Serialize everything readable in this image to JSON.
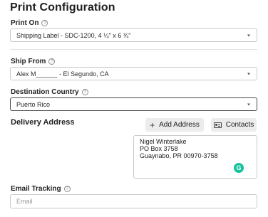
{
  "panel": {
    "title": "Print Configuration"
  },
  "print_on": {
    "label": "Print On",
    "value": "Shipping Label - SDC-1200, 4 ¼\" x 6 ¾\""
  },
  "ship_from": {
    "label": "Ship From",
    "value": "Alex M______ - El Segundo, CA"
  },
  "destination_country": {
    "label": "Destination Country",
    "value": "Puerto Rico"
  },
  "delivery_address": {
    "label": "Delivery Address",
    "add_button_label": "Add Address",
    "contacts_button_label": "Contacts",
    "lines": [
      "Nigel Winterlake",
      "PO Box 3758",
      "Guaynabo, PR 00970-3758"
    ],
    "grammarly_letter": "G"
  },
  "email_tracking": {
    "label": "Email Tracking",
    "placeholder": "Email"
  },
  "icons": {
    "help": "?",
    "plus": "+"
  },
  "colors": {
    "grammarly": "#15c39a",
    "button_bg": "#ececec"
  }
}
